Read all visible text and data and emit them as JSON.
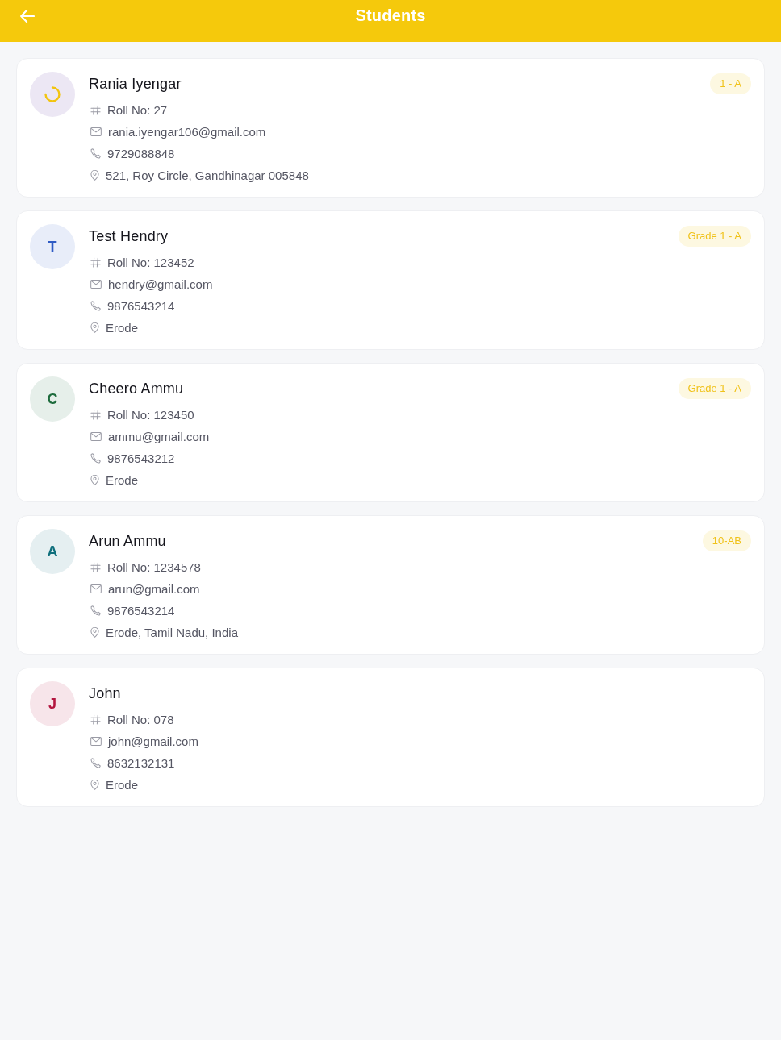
{
  "header": {
    "title": "Students"
  },
  "students": [
    {
      "name": "Rania Iyengar",
      "avatar": {
        "kind": "spinner",
        "color": "#f2c40f"
      },
      "badge": "1 - A",
      "roll": "Roll No: 27",
      "email": "rania.iyengar106@gmail.com",
      "phone": "9729088848",
      "address": "521, Roy Circle, Gandhinagar 005848"
    },
    {
      "name": "Test Hendry",
      "avatar": {
        "kind": "initial",
        "letter": "T",
        "color": "#2f5bc4"
      },
      "badge": "Grade 1 - A",
      "roll": "Roll No: 123452",
      "email": "hendry@gmail.com",
      "phone": "9876543214",
      "address": "Erode"
    },
    {
      "name": "Cheero Ammu",
      "avatar": {
        "kind": "initial",
        "letter": "C",
        "color": "#1d6b3c"
      },
      "badge": "Grade 1 - A",
      "roll": "Roll No: 123450",
      "email": "ammu@gmail.com",
      "phone": "9876543212",
      "address": "Erode"
    },
    {
      "name": "Arun Ammu",
      "avatar": {
        "kind": "initial",
        "letter": "A",
        "color": "#0f6f7c"
      },
      "badge": "10-AB",
      "roll": "Roll No: 1234578",
      "email": "arun@gmail.com",
      "phone": "9876543214",
      "address": "Erode, Tamil Nadu, India"
    },
    {
      "name": "John",
      "avatar": {
        "kind": "initial",
        "letter": "J",
        "color": "#b3163f"
      },
      "roll": "Roll No: 078",
      "email": "john@gmail.com",
      "phone": "8632132131",
      "address": "Erode"
    }
  ]
}
